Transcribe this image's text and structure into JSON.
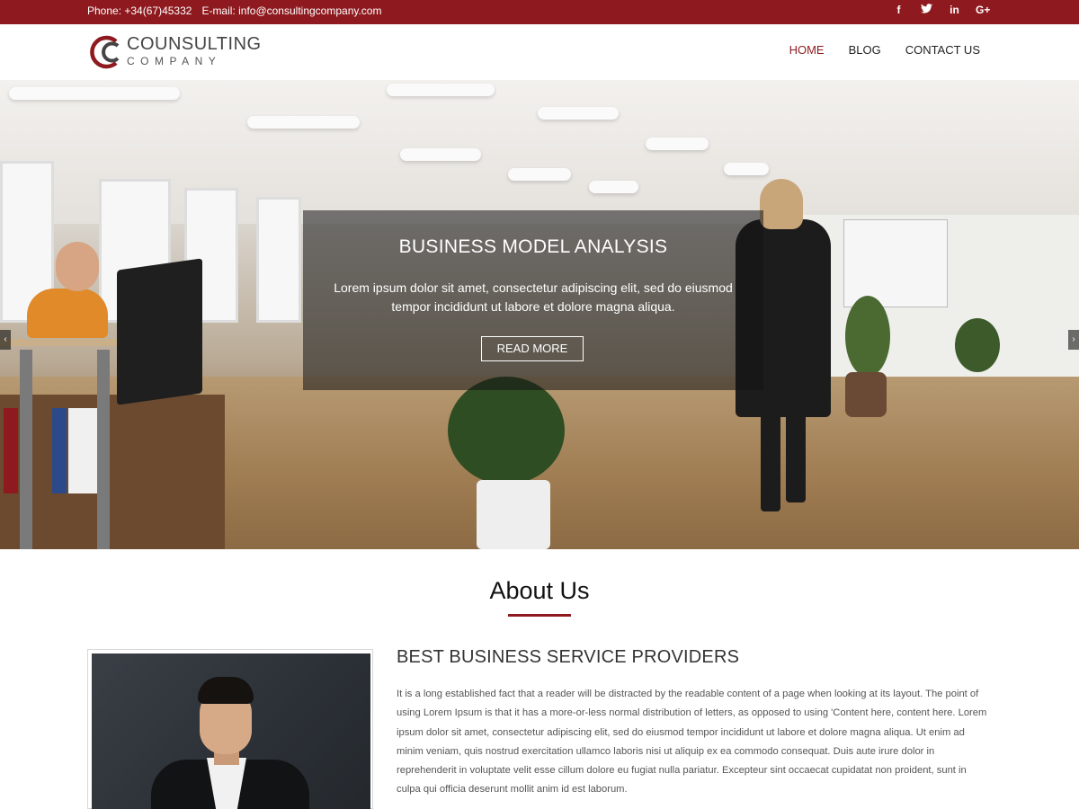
{
  "topbar": {
    "phone": "Phone: +34(67)45332",
    "email": "E-mail: info@consultingcompany.com",
    "social": [
      {
        "icon": "facebook-icon",
        "glyph": "f"
      },
      {
        "icon": "twitter-icon",
        "glyph": "t"
      },
      {
        "icon": "linkedin-icon",
        "glyph": "in"
      },
      {
        "icon": "google-plus-icon",
        "glyph": "G+"
      }
    ]
  },
  "brand": {
    "line1": "COUNSULTING",
    "line2": "COMPANY",
    "accent": "#8e1a1f"
  },
  "nav": {
    "home": "HOME",
    "blog": "BLOG",
    "contact": "CONTACT US"
  },
  "hero": {
    "title": "BUSINESS MODEL ANALYSIS",
    "text": "Lorem ipsum dolor sit amet, consectetur adipiscing elit, sed do eiusmod tempor incididunt ut labore et dolore magna aliqua.",
    "button": "READ MORE",
    "prev": "‹",
    "next": "›"
  },
  "about": {
    "title": "About Us",
    "heading": "BEST BUSINESS SERVICE PROVIDERS",
    "body": "It is a long established fact that a reader will be distracted by the readable content of a page when looking at its layout. The point of using Lorem Ipsum is that it has a more-or-less normal distribution of letters, as opposed to using 'Content here, content here. Lorem ipsum dolor sit amet, consectetur adipiscing elit, sed do eiusmod tempor incididunt ut labore et dolore magna aliqua. Ut enim ad minim veniam, quis nostrud exercitation ullamco laboris nisi ut aliquip ex ea commodo consequat. Duis aute irure dolor in reprehenderit in voluptate velit esse cillum dolore eu fugiat nulla pariatur. Excepteur sint occaecat cupidatat non proident, sunt in culpa qui officia deserunt mollit anim id est laborum."
  }
}
